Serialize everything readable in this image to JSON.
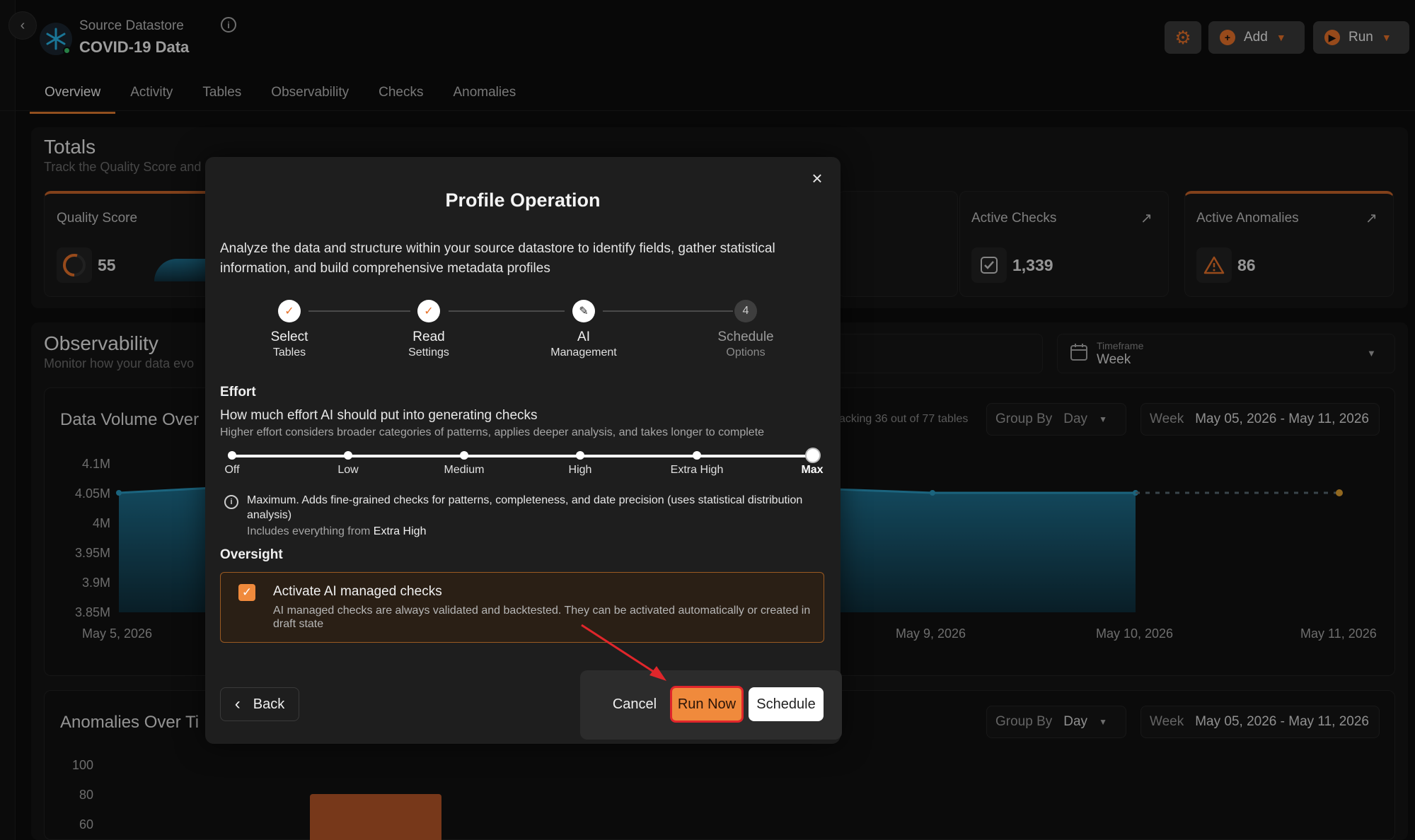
{
  "header": {
    "datastore_subtitle": "Source Datastore",
    "datastore_title": "COVID-19 Data",
    "add_label": "Add",
    "run_label": "Run"
  },
  "tabs": [
    "Overview",
    "Activity",
    "Tables",
    "Observability",
    "Checks",
    "Anomalies"
  ],
  "totals": {
    "title": "Totals",
    "subtitle": "Track the Quality Score and",
    "quality_score_label": "Quality Score",
    "quality_score_value": "55",
    "active_checks_label": "Active Checks",
    "active_checks_value": "1,339",
    "active_anomalies_label": "Active Anomalies",
    "active_anomalies_value": "86"
  },
  "observability": {
    "title": "Observability",
    "subtitle": "Monitor how your data evo",
    "timeframe_label": "Timeframe",
    "timeframe_value": "Week",
    "volume_title": "Data Volume Over",
    "tracking_text": "acking 36 out of 77 tables",
    "group_by_label": "Group By",
    "group_by_value": "Day",
    "week_label": "Week",
    "date_range": "May 05, 2026 - May 11, 2026",
    "y_ticks": [
      "4.1M",
      "4.05M",
      "4M",
      "3.95M",
      "3.9M",
      "3.85M"
    ],
    "x_ticks": [
      "May 5, 2026",
      "May 9, 2026",
      "May 10, 2026",
      "May 11, 2026"
    ],
    "anomalies_title": "Anomalies Over Ti",
    "anomaly_y_ticks": [
      "100",
      "80",
      "60"
    ]
  },
  "modal": {
    "title": "Profile Operation",
    "description": "Analyze the data and structure within your source datastore to identify fields, gather statistical information, and build comprehensive metadata profiles",
    "steps": [
      {
        "l1": "Select",
        "l2": "Tables",
        "state": "done"
      },
      {
        "l1": "Read",
        "l2": "Settings",
        "state": "done"
      },
      {
        "l1": "AI",
        "l2": "Management",
        "state": "current"
      },
      {
        "l1": "Schedule",
        "l2": "Options",
        "state": "pending",
        "num": "4"
      }
    ],
    "effort_title": "Effort",
    "effort_question": "How much effort AI should put into generating checks",
    "effort_help": "Higher effort considers broader categories of patterns, applies deeper analysis, and takes longer to complete",
    "effort_levels": [
      "Off",
      "Low",
      "Medium",
      "High",
      "Extra High",
      "Max"
    ],
    "effort_selected": "Max",
    "effort_info": "Maximum. Adds fine-grained checks for patterns, completeness, and date precision (uses statistical distribution analysis)",
    "effort_includes_prefix": "Includes everything from",
    "effort_includes_level": "Extra High",
    "oversight_title": "Oversight",
    "oversight_checkbox_label": "Activate AI managed checks",
    "oversight_checkbox_checked": true,
    "oversight_checkbox_help": "AI managed checks are always validated and backtested. They can be activated automatically or created in draft state",
    "back_label": "Back",
    "cancel_label": "Cancel",
    "run_now_label": "Run Now",
    "schedule_label": "Schedule"
  },
  "colors": {
    "accent": "#e8722a",
    "chart_fill": "#1e6f8e",
    "annotation_red": "#e0262b"
  }
}
